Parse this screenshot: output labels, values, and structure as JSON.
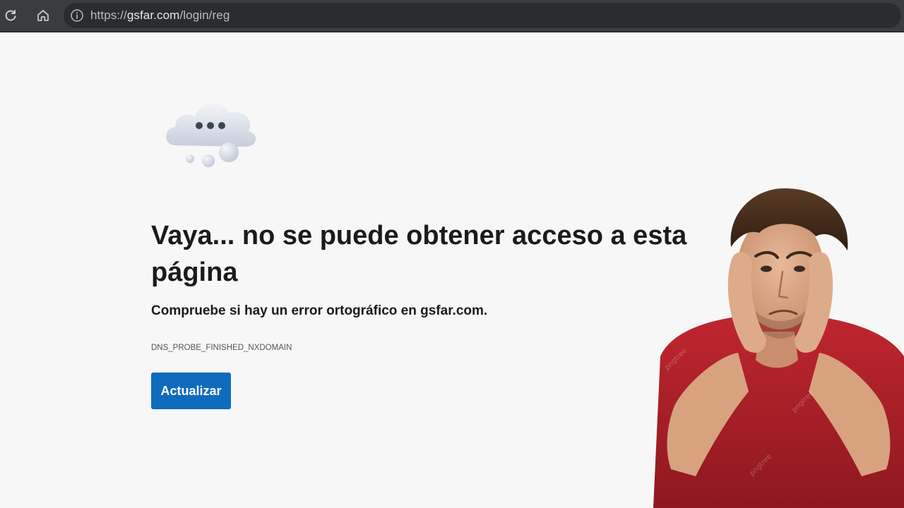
{
  "browser": {
    "toolbar": {
      "reload_icon": "reload-icon",
      "home_icon": "home-icon"
    },
    "address_bar": {
      "info_icon": "info-icon",
      "scheme": "https://",
      "host": "gsfar.com",
      "path": "/login/reg"
    }
  },
  "error_page": {
    "illustration": "cloud-thinking-icon",
    "title": "Vaya... no se puede obtener acceso a esta página",
    "description": "Compruebe si hay un error ortográfico en gsfar.com.",
    "code": "DNS_PROBE_FINISHED_NXDOMAIN",
    "refresh_label": "Actualizar"
  },
  "overlay": {
    "photo": "frustrated-man-illustration",
    "watermark": "pngtree"
  },
  "colors": {
    "toolbar_bg": "#3b3c3f",
    "address_bar_bg": "#2b2c2e",
    "page_bg": "#f7f7f7",
    "button_accent": "#0f6cbd",
    "shirt": "#b3202b"
  }
}
